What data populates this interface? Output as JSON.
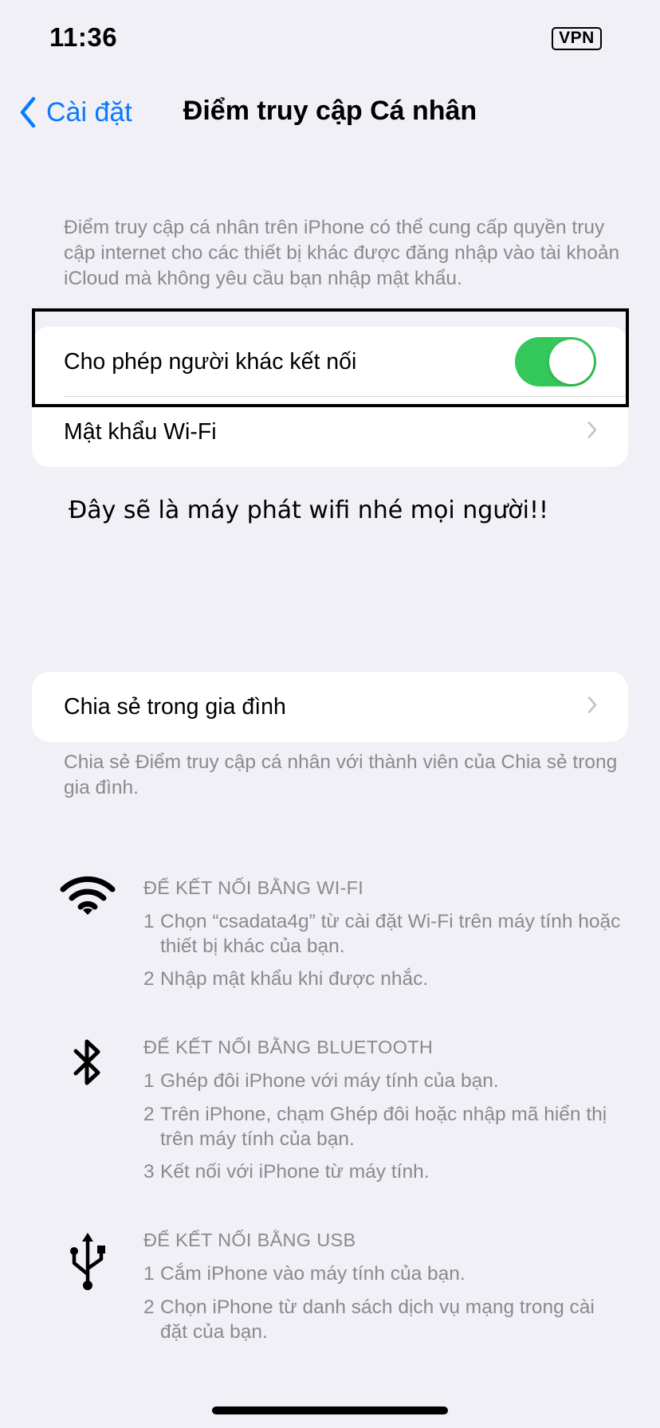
{
  "status_bar": {
    "time": "11:36",
    "vpn_label": "VPN"
  },
  "nav": {
    "back_label": "Cài đặt",
    "title": "Điểm truy cập Cá nhân"
  },
  "intro_description": "Điểm truy cập cá nhân trên iPhone có thể cung cấp quyền truy cập internet cho các thiết bị khác được đăng nhập vào tài khoản iCloud mà không yêu cầu bạn nhập mật khẩu.",
  "settings_group": {
    "allow_others_label": "Cho phép người khác kết nối",
    "allow_others_enabled": true,
    "wifi_password_label": "Mật khẩu Wi-Fi"
  },
  "annotation_caption": "Đây sẽ là máy phát wifi nhé mọi người!!",
  "family_sharing": {
    "label": "Chia sẻ trong gia đình",
    "description": "Chia sẻ Điểm truy cập cá nhân với thành viên của Chia sẻ trong gia đình."
  },
  "connections": [
    {
      "icon": "wifi-icon",
      "heading": "ĐỂ KẾT NỐI BẰNG WI-FI",
      "steps": [
        {
          "num": "1",
          "text": "Chọn “csadata4g” từ cài đặt Wi-Fi trên máy tính hoặc thiết bị khác của bạn."
        },
        {
          "num": "2",
          "text": "Nhập mật khẩu khi được nhắc."
        }
      ]
    },
    {
      "icon": "bluetooth-icon",
      "heading": "ĐỂ KẾT NỐI BẰNG BLUETOOTH",
      "steps": [
        {
          "num": "1",
          "text": "Ghép đôi iPhone với máy tính của bạn."
        },
        {
          "num": "2",
          "text": "Trên iPhone, chạm Ghép đôi hoặc nhập mã hiển thị trên máy tính của bạn."
        },
        {
          "num": "3",
          "text": "Kết nối với iPhone từ máy tính."
        }
      ]
    },
    {
      "icon": "usb-icon",
      "heading": "ĐỂ KẾT NỐI BẰNG USB",
      "steps": [
        {
          "num": "1",
          "text": "Cắm iPhone vào máy tính của bạn."
        },
        {
          "num": "2",
          "text": "Chọn iPhone từ danh sách dịch vụ mạng trong cài đặt của bạn."
        }
      ]
    }
  ],
  "colors": {
    "background": "#F0F0F6",
    "accent_blue": "#0A7AFF",
    "toggle_on": "#34C759",
    "secondary_text": "#8A8A8E"
  }
}
